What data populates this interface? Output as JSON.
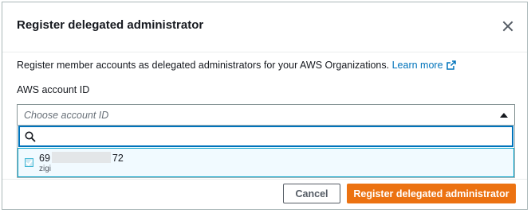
{
  "modal": {
    "title": "Register delegated administrator",
    "description": "Register member accounts as delegated administrators for your AWS Organizations.",
    "learn_more": "Learn more"
  },
  "field": {
    "label": "AWS account ID",
    "placeholder": "Choose account ID",
    "filter_placeholder": "",
    "filter_value": ""
  },
  "options": [
    {
      "account_id_prefix": "69",
      "account_id_suffix": "72",
      "account_id_redacted": true,
      "name": "zigi",
      "checked": true
    }
  ],
  "buttons": {
    "cancel": "Cancel",
    "primary": "Register delegated administrator"
  },
  "colors": {
    "primary": "#ec7211",
    "link": "#0073bb",
    "focus": "#0073bb",
    "selected_bg": "#f1faff"
  },
  "icons": {
    "close": "close-icon",
    "external": "external-link-icon",
    "caret": "caret-up-icon",
    "search": "search-icon",
    "check": "check-icon"
  }
}
